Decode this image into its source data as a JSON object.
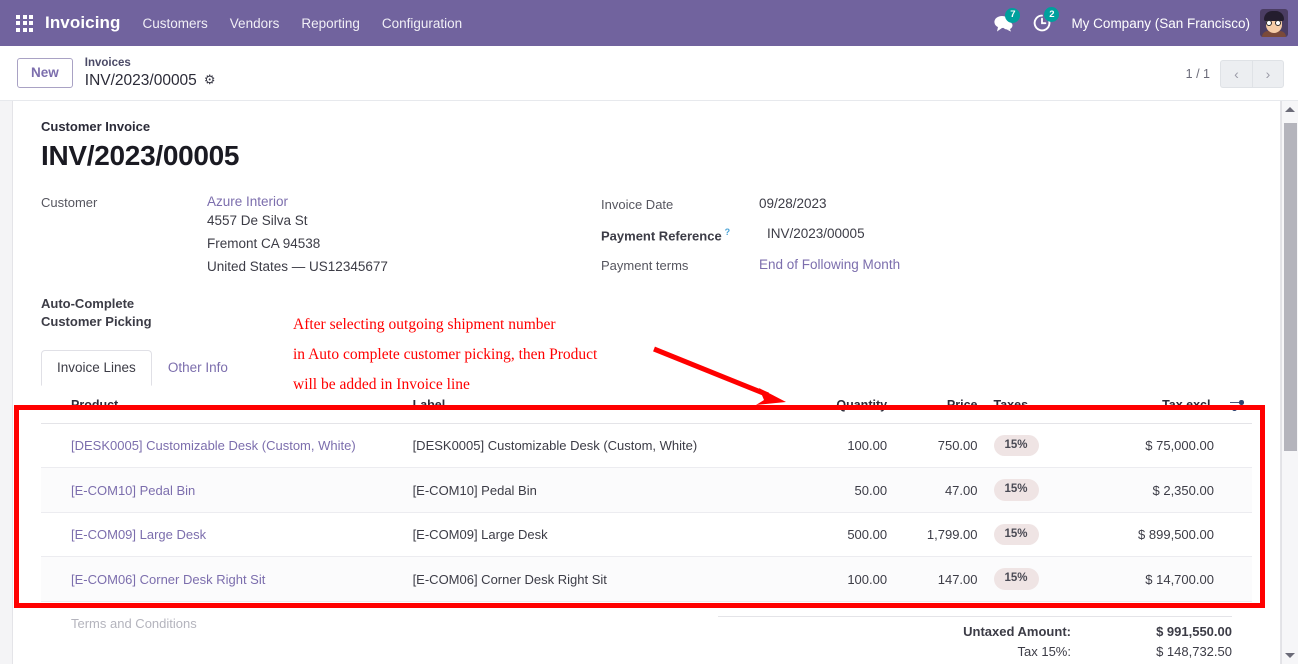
{
  "navbar": {
    "apps_icon": "apps-grid-icon",
    "brand": "Invoicing",
    "menu": [
      {
        "label": "Customers"
      },
      {
        "label": "Vendors"
      },
      {
        "label": "Reporting"
      },
      {
        "label": "Configuration"
      }
    ],
    "messages_icon": "chat-bubble-icon",
    "messages_count": "7",
    "activities_icon": "clock-activity-icon",
    "activities_count": "2",
    "company": "My Company (San Francisco)",
    "avatar_icon": "user-avatar",
    "accent_color": "#71639e",
    "badge_color": "#00a09d"
  },
  "controlpanel": {
    "new_label": "New",
    "breadcrumb_parent": "Invoices",
    "breadcrumb_current": "INV/2023/00005",
    "gear_icon": "gear-icon",
    "pager_count": "1 / 1",
    "prev_icon": "chevron-left-icon",
    "next_icon": "chevron-right-icon"
  },
  "record": {
    "doc_kind": "Customer Invoice",
    "doc_title": "INV/2023/00005",
    "customer_label": "Customer",
    "customer_name": "Azure Interior",
    "customer_address": [
      "4557 De Silva St",
      "Fremont CA 94538",
      "United States — US12345677"
    ],
    "autocomplete_label_line1": "Auto-Complete",
    "autocomplete_label_line2": "Customer Picking",
    "invoice_date_label": "Invoice Date",
    "invoice_date_value": "09/28/2023",
    "payment_reference_label": "Payment Reference",
    "payment_reference_help": "?",
    "payment_reference_value": "INV/2023/00005",
    "payment_terms_label": "Payment terms",
    "payment_terms_value": "End of Following Month"
  },
  "tabs": [
    {
      "label": "Invoice Lines",
      "active": true
    },
    {
      "label": "Other Info",
      "active": false
    }
  ],
  "annotation": {
    "line1": "After selecting outgoing shipment number",
    "line2": "in Auto complete customer picking, then Product",
    "line3": "will be added in Invoice line",
    "color": "#ff0000",
    "arrow_icon": "red-arrow-icon",
    "box_icon": "red-highlight-box"
  },
  "table": {
    "columns": {
      "product": "Product",
      "label": "Label",
      "quantity": "Quantity",
      "price": "Price",
      "taxes": "Taxes",
      "tax_excl": "Tax excl.",
      "options_icon": "column-options-icon"
    },
    "rows": [
      {
        "product": "[DESK0005] Customizable Desk (Custom, White)",
        "label": "[DESK0005] Customizable Desk (Custom, White)",
        "quantity": "100.00",
        "price": "750.00",
        "taxes": "15%",
        "tax_excl": "$ 75,000.00"
      },
      {
        "product": "[E-COM10] Pedal Bin",
        "label": "[E-COM10] Pedal Bin",
        "quantity": "50.00",
        "price": "47.00",
        "taxes": "15%",
        "tax_excl": "$ 2,350.00"
      },
      {
        "product": "[E-COM09] Large Desk",
        "label": "[E-COM09] Large Desk",
        "quantity": "500.00",
        "price": "1,799.00",
        "taxes": "15%",
        "tax_excl": "$ 899,500.00"
      },
      {
        "product": "[E-COM06] Corner Desk Right Sit",
        "label": "[E-COM06] Corner Desk Right Sit",
        "quantity": "100.00",
        "price": "147.00",
        "taxes": "15%",
        "tax_excl": "$ 14,700.00"
      }
    ]
  },
  "footer": {
    "terms_placeholder": "Terms and Conditions",
    "totals": [
      {
        "label": "Untaxed Amount:",
        "value": "$ 991,550.00",
        "bold": true
      },
      {
        "label": "Tax 15%:",
        "value": "$ 148,732.50",
        "bold": false
      }
    ]
  },
  "scrollbar": {
    "up_icon": "scroll-up-arrow-icon",
    "down_icon": "scroll-down-arrow-icon",
    "thumb": "scrollbar-thumb"
  }
}
